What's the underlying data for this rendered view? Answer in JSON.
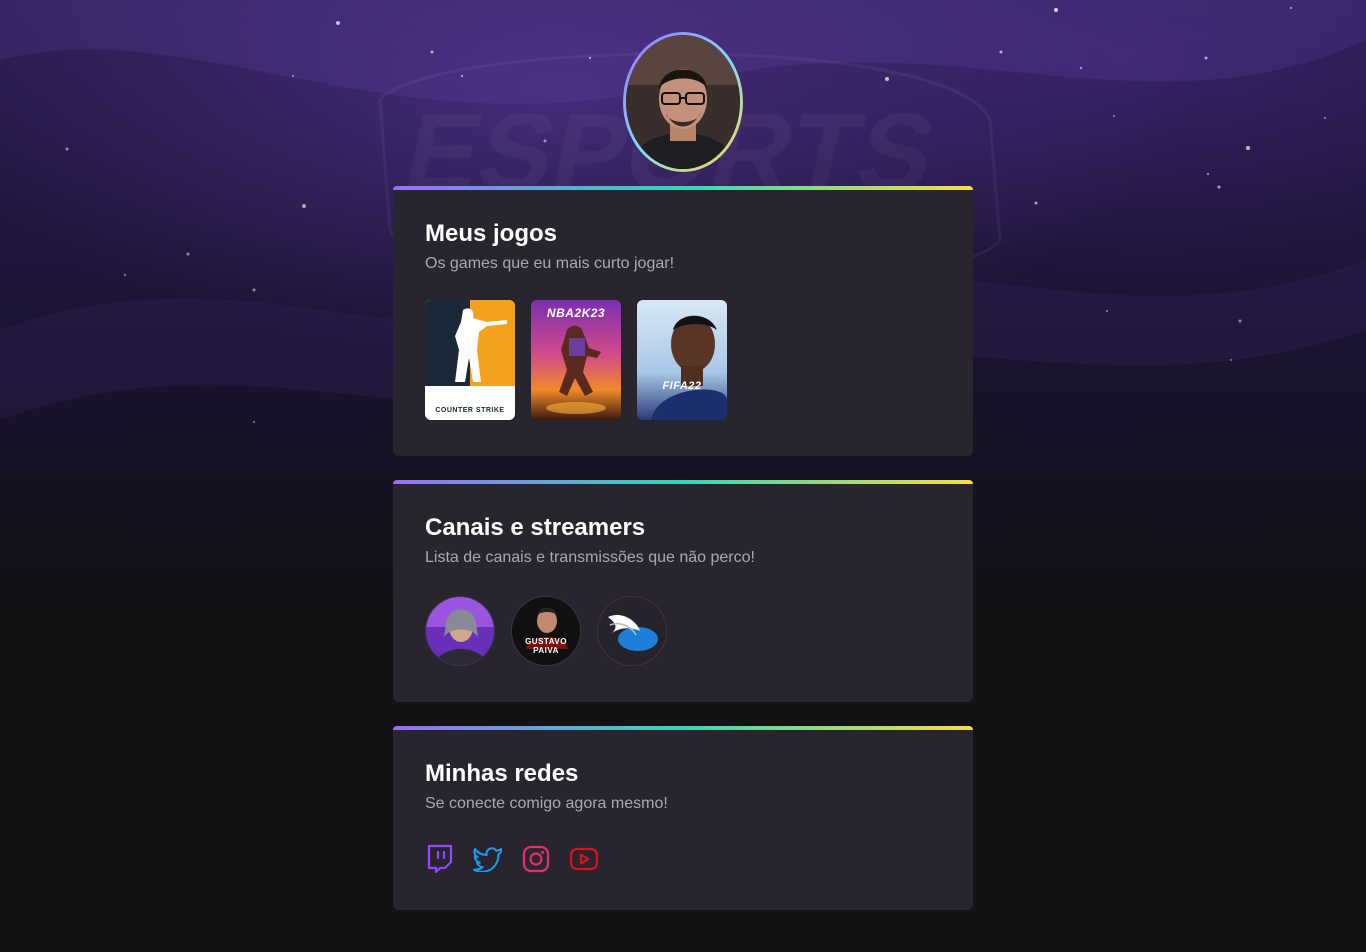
{
  "profile": {
    "avatar_alt": "Foto de perfil"
  },
  "cards": {
    "games": {
      "title": "Meus jogos",
      "subtitle": "Os games que eu mais curto jogar!",
      "items": [
        {
          "name": "Counter-Strike",
          "caption": "COUNTER STRIKE"
        },
        {
          "name": "NBA 2K23",
          "caption": "NBA2K23"
        },
        {
          "name": "FIFA 22",
          "caption": "FIFA22"
        }
      ]
    },
    "streamers": {
      "title": "Canais e streamers",
      "subtitle": "Lista de canais e transmissões que não perco!",
      "items": [
        {
          "name": "streamer-1",
          "caption": ""
        },
        {
          "name": "Gustavo Paiva",
          "caption": "GUSTAVO PAIVA"
        },
        {
          "name": "streamer-3",
          "caption": ""
        }
      ]
    },
    "socials": {
      "title": "Minhas redes",
      "subtitle": "Se conecte comigo agora mesmo!",
      "items": [
        {
          "icon": "twitch-icon",
          "color": "#9146FF"
        },
        {
          "icon": "twitter-icon",
          "color": "#1D9BF0"
        },
        {
          "icon": "instagram-icon",
          "color": "#E4405F"
        },
        {
          "icon": "youtube-icon",
          "color": "#FF0000"
        }
      ]
    }
  },
  "colors": {
    "background": "#121214",
    "card": "#29252f",
    "gradient": [
      "#996DFF",
      "#33D8B6",
      "#F7DD43"
    ]
  }
}
